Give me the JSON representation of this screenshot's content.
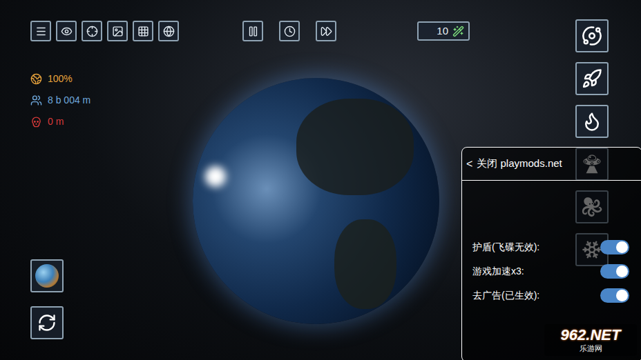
{
  "counter": {
    "value": "10"
  },
  "stats": [
    {
      "text": "100%",
      "color": "#e8a33c"
    },
    {
      "text": "8 b 004 m",
      "color": "#6fa8dc"
    },
    {
      "text": "0 m",
      "color": "#d83a3a"
    }
  ],
  "mod_menu": {
    "back": "<",
    "title": "关闭 playmods.net",
    "options": [
      {
        "label": "护盾(飞碟无效):",
        "on": true
      },
      {
        "label": "游戏加速x3:",
        "on": true
      },
      {
        "label": "去广告(已生效):",
        "on": true
      }
    ]
  },
  "watermark": {
    "logo": "962.NET",
    "subtitle": "乐游网"
  }
}
